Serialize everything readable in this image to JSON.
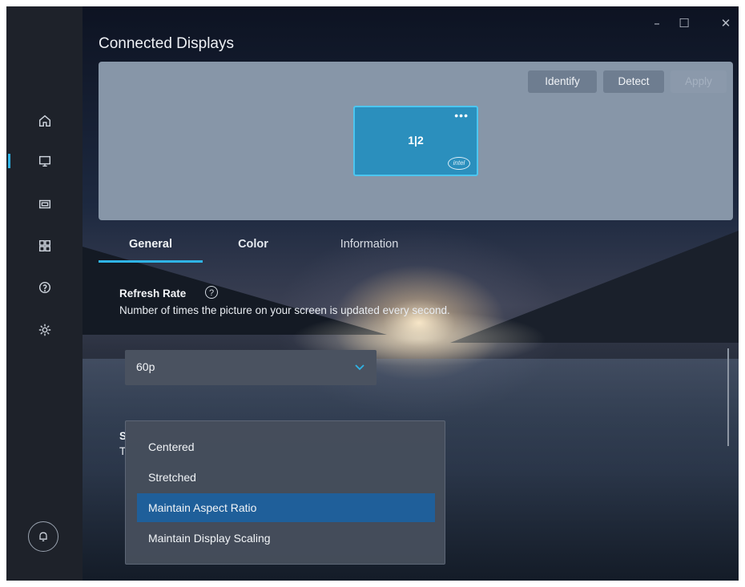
{
  "header": {
    "title": "Connected Displays"
  },
  "window_controls": {
    "minimize": "–",
    "maximize": "☐",
    "close": "✕"
  },
  "sidebar": {
    "items": [
      {
        "name": "home",
        "icon": "home-icon"
      },
      {
        "name": "display",
        "icon": "monitor-icon",
        "active": true
      },
      {
        "name": "video",
        "icon": "video-icon"
      },
      {
        "name": "apps",
        "icon": "grid-icon"
      },
      {
        "name": "help",
        "icon": "question-icon"
      },
      {
        "name": "settings",
        "icon": "gear-icon"
      }
    ],
    "bell_icon": "bell-icon"
  },
  "display_panel": {
    "buttons": {
      "identify": "Identify",
      "detect": "Detect",
      "apply": "Apply"
    },
    "monitor": {
      "label": "1|2",
      "menu": "•••",
      "logo": "intel"
    }
  },
  "tabs": [
    {
      "label": "General",
      "active": true
    },
    {
      "label": "Color"
    },
    {
      "label": "Information"
    }
  ],
  "refresh_rate": {
    "title": "Refresh Rate",
    "help": "?",
    "description": "Number of times the picture on your screen is updated every second.",
    "value": "60p"
  },
  "scaling": {
    "label_fragment": "S",
    "desc_fragment": "T",
    "options": [
      "Centered",
      "Stretched",
      "Maintain Aspect Ratio",
      "Maintain Display Scaling"
    ],
    "selected": "Maintain Aspect Ratio"
  },
  "colors": {
    "accent": "#2fb4e6",
    "selected_option": "#1f5f9a",
    "panel": "#8796a8"
  }
}
